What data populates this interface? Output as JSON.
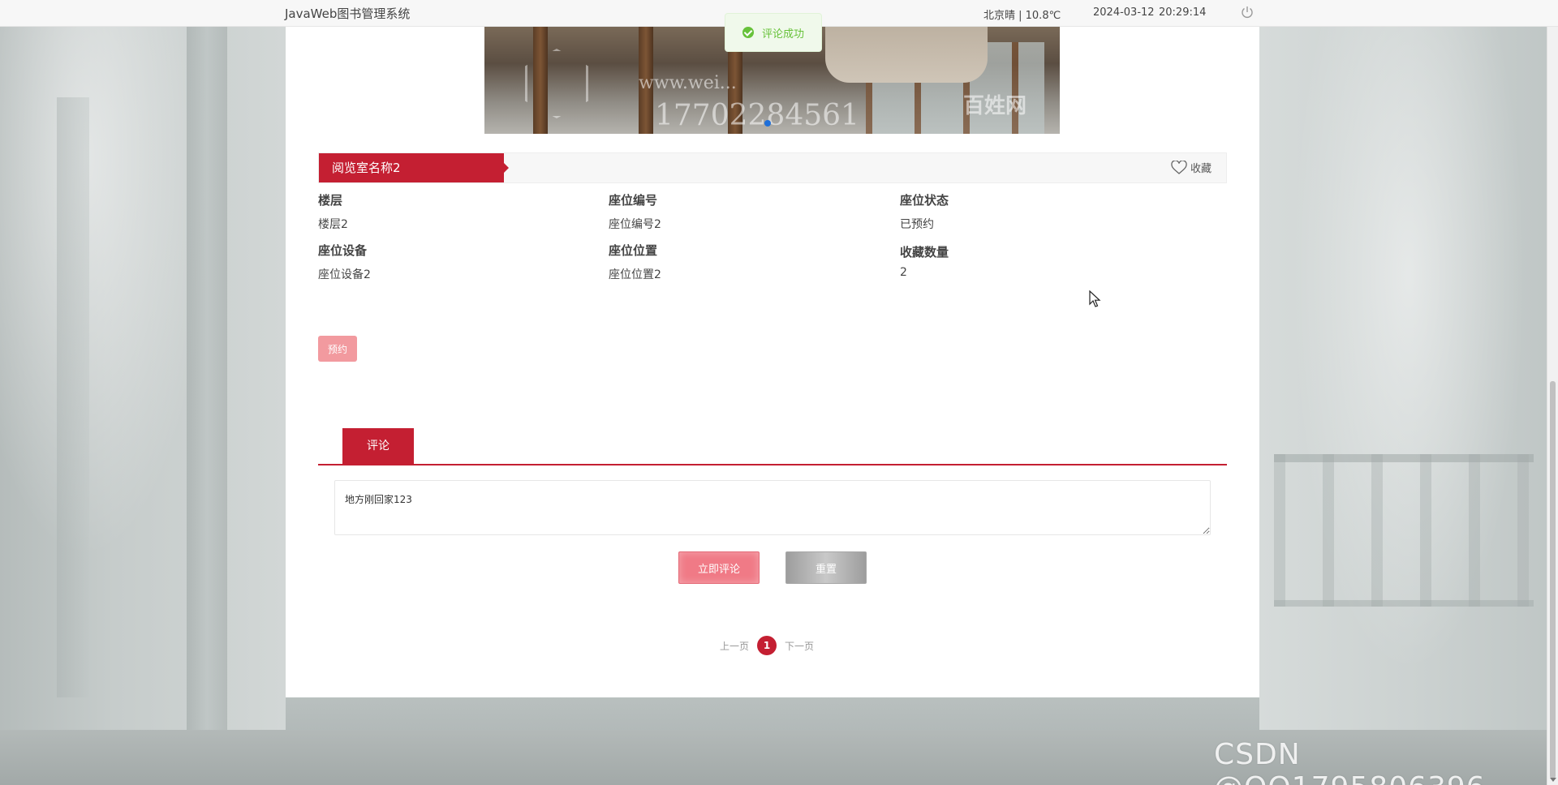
{
  "header": {
    "brand": "JavaWeb图书管理系统",
    "weather": "北京晴 | 10.8℃",
    "date": "2024-03-12",
    "time": "20:29:14",
    "power_icon": "power-icon"
  },
  "toast": {
    "message": "评论成功",
    "icon": "check-circle-icon",
    "color": "#67c23a"
  },
  "hero": {
    "watermark_url": "www.wei...",
    "watermark_phone": "17702284561",
    "watermark_site": "百姓网"
  },
  "room": {
    "title": "阅览室名称2",
    "favorite_label": "收藏",
    "favorite_icon": "heart-icon"
  },
  "details": {
    "floor_label": "楼层",
    "floor_value": "楼层2",
    "seat_no_label": "座位编号",
    "seat_no_value": "座位编号2",
    "seat_status_label": "座位状态",
    "seat_status_value": "已预约",
    "seat_device_label": "座位设备",
    "seat_device_value": "座位设备2",
    "seat_location_label": "座位位置",
    "seat_location_value": "座位位置2",
    "fav_count_label": "收藏数量",
    "fav_count_value": "2"
  },
  "actions": {
    "reserve_label": "预约"
  },
  "tabs": {
    "active_label": "评论"
  },
  "comment": {
    "value": "地方刚回家123",
    "submit_label": "立即评论",
    "reset_label": "重置"
  },
  "pager": {
    "prev_label": "上一页",
    "current_page": "1",
    "next_label": "下一页"
  },
  "watermark": "CSDN @QQ1795806396",
  "colors": {
    "brand_red": "#c41f32",
    "reserve_button": "#f29a9f",
    "submit_button": "#f07a86"
  }
}
